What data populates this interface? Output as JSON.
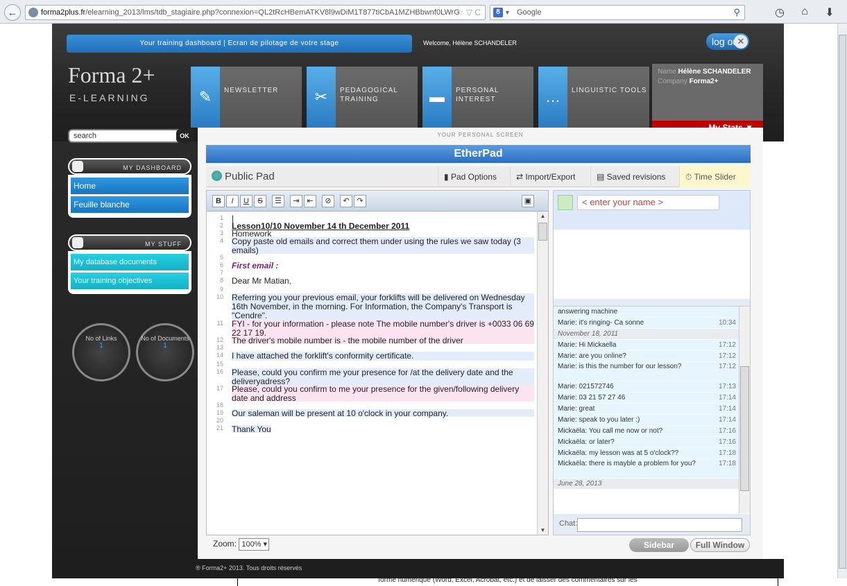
{
  "browser": {
    "url_host": "forma2plus.fr",
    "url_path": "/elearning_2013/lms/tdb_stagiaire.php?connexion=QL2tRcHBemATKV8l9wDiM1T877tiCbA1MZHBbwnf0LWrG",
    "url_icons": "☆ ▽ C",
    "search_engine": "Google"
  },
  "header": {
    "topbar": "Your training dashboard  |  Ecran de pilotage de votre stage",
    "welcome": "Welcome, Hélène SCHANDELER",
    "logout": "log out",
    "logo": "Forma 2+",
    "logo_sub": "E-LEARNING",
    "nav": [
      {
        "label": "NEWSLETTER",
        "icon": "✎"
      },
      {
        "label": "PEDAGOGICAL TRAINING",
        "icon": "✂"
      },
      {
        "label": "PERSONAL INTEREST",
        "icon": "▬"
      },
      {
        "label": "LINGUISTIC TOOLS",
        "icon": "…"
      }
    ],
    "user": {
      "name_label": "Name",
      "name": "Hélène SCHANDELER",
      "company_label": "Company",
      "company": "Forma2+",
      "stats": "My Stats  ▼"
    }
  },
  "sidebar": {
    "search_placeholder": "search",
    "search_ok": "OK",
    "dashboard_title": "MY DASHBOARD",
    "dashboard_items": [
      "Home",
      "Feuille blanche"
    ],
    "stuff_title": "MY STUFF",
    "stuff_items": [
      "My database documents",
      "Your training objectives"
    ],
    "counter_links": {
      "label": "No of Links",
      "value": "1"
    },
    "counter_docs": {
      "label": "No of Documents",
      "value": "1"
    }
  },
  "main": {
    "screen_title": "YOUR PERSONAL SCREEN",
    "etherpad_title": "EtherPad",
    "pad_name": "Public Pad",
    "tabs": [
      "Pad Options",
      "Import/Export",
      "Saved revisions",
      "Time Slider"
    ],
    "name_placeholder": "< enter your name >",
    "zoom_label": "Zoom:",
    "zoom_value": "100%",
    "sidebar_btn": "Sidebar",
    "fullwindow_btn": "Full Window",
    "chat_label": "Chat:"
  },
  "editor_lines": {
    "l2": "Lesson10/10 November 14 th December 2011",
    "l3": "Homework",
    "l4": "Copy paste old emails and correct them under using the rules we saw today (3 emails)",
    "l6": "First email :",
    "l8": "Dear Mr Matian,",
    "l10": "Referring you your previous email, your forklifts will be delivered on Wednesday 16th November, in the morning. For Information, the Company's Transport is \"Cendre\".",
    "l11": "FYI - for your information - please note The mobile number's driver is +0033 06 69 22 17 19.",
    "l12": "The driver's mobile number is - the mobile number of the driver",
    "l14": "I have attached the forklift's conformity certificate.",
    "l16": "Please, could you confirm me your presence for /at  the delivery date and the deliveryadress?",
    "l17": "Please, could you confirm to me your presence for the given/following delivery date and address",
    "l19": "Our saleman will be present at 10  o'clock in your company.",
    "l21": "Thank You"
  },
  "chat": [
    {
      "text": "answering machine",
      "time": ""
    },
    {
      "text": "Marie: it's ringing- Ca sonne",
      "time": "10:34"
    },
    {
      "text": "November 18, 2011",
      "time": "",
      "date": true
    },
    {
      "text": "Marie: Hi Mickaella",
      "time": "17:12"
    },
    {
      "text": "Marie: are you online?",
      "time": "17:12"
    },
    {
      "text": "Marie: is this the number for our lesson?",
      "time": "17:12"
    },
    {
      "text": "Marie: 021572746",
      "time": "17:13"
    },
    {
      "text": "Marie: 03 21 57 27 46",
      "time": "17:14"
    },
    {
      "text": "Marie: great",
      "time": "17:14"
    },
    {
      "text": "Marie: speak to you later :)",
      "time": "17:14"
    },
    {
      "text": "Mickaëla: You call me now or not?",
      "time": "17:16"
    },
    {
      "text": "Mickaëla: or later?",
      "time": "17:16"
    },
    {
      "text": "Mickaëla: my lesson was at 5 o'clock??",
      "time": "17:18"
    },
    {
      "text": "Mickaëla: there is mayble a problem for you?",
      "time": "17:18"
    },
    {
      "text": "June 28, 2013",
      "time": "",
      "date": true
    }
  ],
  "footer": "® Forma2+ 2013. Tous droits réservés",
  "behind_text": "forme numérique (Word, Excel, Acrobat, etc.) et de laisser des commentaires sur les"
}
